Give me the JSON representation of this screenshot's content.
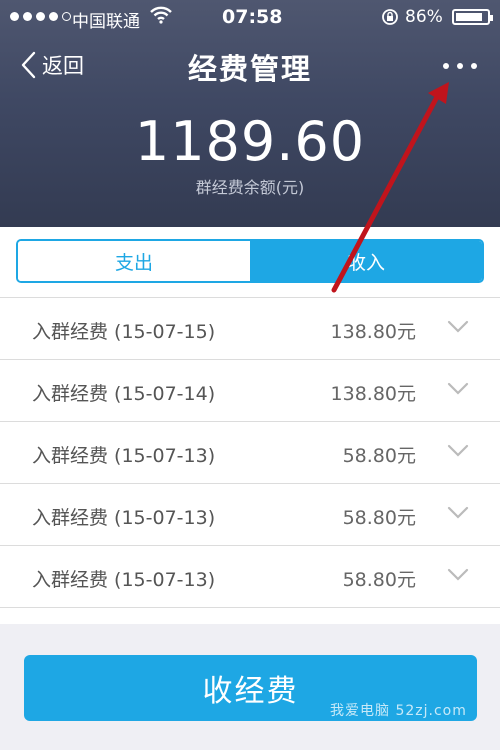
{
  "status_bar": {
    "carrier": "中国联通",
    "time": "07:58",
    "battery_percent": "86%",
    "battery_level": 0.86,
    "signal_bars_filled": 4,
    "signal_bars_total": 5
  },
  "header": {
    "back_label": "返回",
    "title": "经费管理",
    "balance": "1189.60",
    "balance_label": "群经费余额(元)"
  },
  "tabs": [
    {
      "label": "支出",
      "active": false
    },
    {
      "label": "收入",
      "active": true
    }
  ],
  "items": [
    {
      "title": "入群经费 (15-07-15)",
      "amount": "138.80元"
    },
    {
      "title": "入群经费 (15-07-14)",
      "amount": "138.80元"
    },
    {
      "title": "入群经费 (15-07-13)",
      "amount": "58.80元"
    },
    {
      "title": "入群经费 (15-07-13)",
      "amount": "58.80元"
    },
    {
      "title": "入群经费 (15-07-13)",
      "amount": "58.80元"
    }
  ],
  "primary_button": {
    "label": "收经费"
  },
  "icons": {
    "back": "chevron-left-icon",
    "more": "more-dots-icon",
    "expand": "chevron-down-icon",
    "wifi": "wifi-icon",
    "rotation_lock": "rotation-lock-icon",
    "battery": "battery-icon"
  },
  "colors": {
    "accent": "#1ea7e4",
    "header_bg": "#3f4863",
    "annotation_arrow": "#c0141c"
  },
  "watermark": "我爱电脑 52zj.com"
}
